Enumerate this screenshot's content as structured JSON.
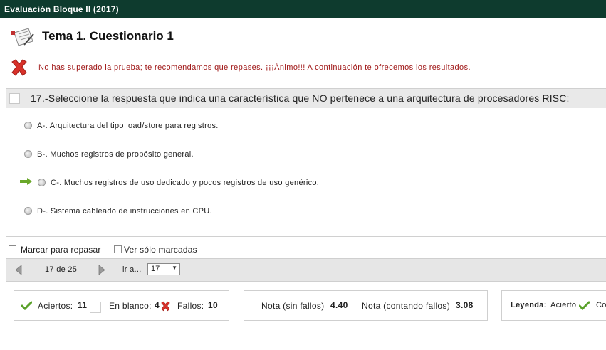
{
  "window": {
    "title": "Evaluación Bloque II (2017)"
  },
  "test": {
    "title": "Tema 1. Cuestionario 1"
  },
  "result": {
    "message": "No has superado la prueba; te recomendamos que repases. ¡¡¡Ánimo!!! A continuación te ofrecemos los resultados."
  },
  "question": {
    "text": "17.-Seleccione la respuesta que indica una característica que NO pertenece a una arquitectura de procesadores RISC:"
  },
  "answers": [
    {
      "label": "A-. Arquitectura del tipo load/store para registros."
    },
    {
      "label": "B-. Muchos registros de propósito general."
    },
    {
      "label": "C-. Muchos registros de uso dedicado y pocos registros de uso genérico."
    },
    {
      "label": "D-. Sistema cableado de instrucciones en CPU."
    }
  ],
  "correct_answer_index": 2,
  "options": {
    "mark_review": "Marcar para repasar",
    "show_marked": "Ver sólo marcadas"
  },
  "navigation": {
    "position": "17 de 25",
    "goto_label": "ir a...",
    "goto_value": "17"
  },
  "stats": {
    "aciertos_label": "Aciertos:",
    "aciertos": "11",
    "blanco_label": "En blanco:",
    "blanco": "4",
    "fallos_label": "Fallos:",
    "fallos": "10"
  },
  "scores": {
    "sin_fallos_label": "Nota (sin fallos)",
    "sin_fallos": "4.40",
    "con_fallos_label": "Nota (contando fallos)",
    "con_fallos": "3.08"
  },
  "legend": {
    "label": "Leyenda:",
    "acierto": "Acierto",
    "next": "Co"
  },
  "colors": {
    "titlebar": "#0e3b2e",
    "fail_text": "#a01818",
    "correct_green": "#2a8a1a"
  }
}
